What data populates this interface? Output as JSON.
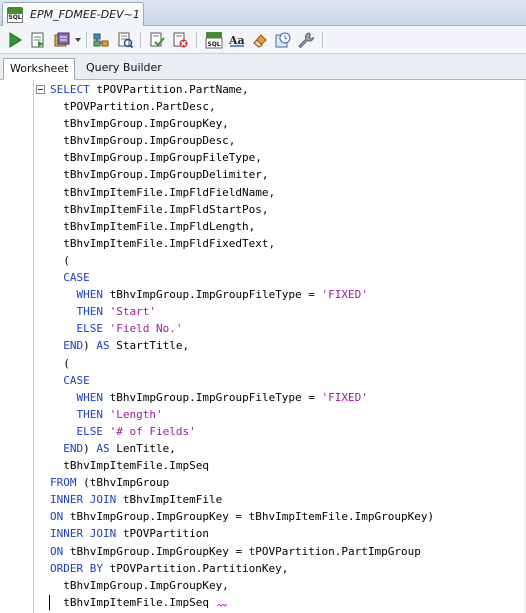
{
  "document_tab": {
    "title": "EPM_FDMEE-DEV~1",
    "icon": "sql-worksheet-icon"
  },
  "toolbar": {
    "buttons": [
      {
        "name": "run-statement-button",
        "icon": "play-icon"
      },
      {
        "name": "run-script-button",
        "icon": "script-icon"
      },
      {
        "name": "autotrace-button",
        "icon": "transaction-icon"
      },
      {
        "name": "explain-plan-button",
        "icon": "explain-plan-icon"
      },
      {
        "name": "sql-tuning-button",
        "icon": "tuning-icon"
      },
      {
        "name": "commit-button",
        "icon": "commit-icon"
      },
      {
        "name": "rollback-button",
        "icon": "rollback-icon"
      },
      {
        "name": "unshared-sql-button",
        "icon": "sql-icon"
      },
      {
        "name": "to-upper-lower-button",
        "icon": "case-icon"
      },
      {
        "name": "clear-button",
        "icon": "eraser-icon"
      },
      {
        "name": "sql-history-button",
        "icon": "history-icon"
      },
      {
        "name": "describe-button",
        "icon": "wrench-icon"
      }
    ]
  },
  "subtabs": {
    "worksheet": "Worksheet",
    "query_builder": "Query Builder",
    "active": "worksheet"
  },
  "editor": {
    "lines": [
      [
        {
          "t": "SELECT ",
          "c": "kw"
        },
        {
          "t": "tPOVPartition.PartName,"
        }
      ],
      [
        {
          "t": "  tPOVPartition.PartDesc,"
        }
      ],
      [
        {
          "t": "  tBhvImpGroup.ImpGroupKey,"
        }
      ],
      [
        {
          "t": "  tBhvImpGroup.ImpGroupDesc,"
        }
      ],
      [
        {
          "t": "  tBhvImpGroup.ImpGroupFileType,"
        }
      ],
      [
        {
          "t": "  tBhvImpGroup.ImpGroupDelimiter,"
        }
      ],
      [
        {
          "t": "  tBhvImpItemFile.ImpFldFieldName,"
        }
      ],
      [
        {
          "t": "  tBhvImpItemFile.ImpFldStartPos,"
        }
      ],
      [
        {
          "t": "  tBhvImpItemFile.ImpFldLength,"
        }
      ],
      [
        {
          "t": "  tBhvImpItemFile.ImpFldFixedText,"
        }
      ],
      [
        {
          "t": "  ("
        }
      ],
      [
        {
          "t": "  "
        },
        {
          "t": "CASE",
          "c": "kw"
        }
      ],
      [
        {
          "t": "    "
        },
        {
          "t": "WHEN ",
          "c": "kw"
        },
        {
          "t": "tBhvImpGroup.ImpGroupFileType = "
        },
        {
          "t": "'FIXED'",
          "c": "str"
        }
      ],
      [
        {
          "t": "    "
        },
        {
          "t": "THEN ",
          "c": "kw"
        },
        {
          "t": "'Start'",
          "c": "str"
        }
      ],
      [
        {
          "t": "    "
        },
        {
          "t": "ELSE ",
          "c": "kw"
        },
        {
          "t": "'Field No.'",
          "c": "str"
        }
      ],
      [
        {
          "t": "  "
        },
        {
          "t": "END",
          "c": "kw"
        },
        {
          "t": ") "
        },
        {
          "t": "AS ",
          "c": "kw"
        },
        {
          "t": "StartTitle,"
        }
      ],
      [
        {
          "t": "  ("
        }
      ],
      [
        {
          "t": "  "
        },
        {
          "t": "CASE",
          "c": "kw"
        }
      ],
      [
        {
          "t": "    "
        },
        {
          "t": "WHEN ",
          "c": "kw"
        },
        {
          "t": "tBhvImpGroup.ImpGroupFileType = "
        },
        {
          "t": "'FIXED'",
          "c": "str"
        }
      ],
      [
        {
          "t": "    "
        },
        {
          "t": "THEN ",
          "c": "kw"
        },
        {
          "t": "'Length'",
          "c": "str"
        }
      ],
      [
        {
          "t": "    "
        },
        {
          "t": "ELSE ",
          "c": "kw"
        },
        {
          "t": "'# of Fields'",
          "c": "str"
        }
      ],
      [
        {
          "t": "  "
        },
        {
          "t": "END",
          "c": "kw"
        },
        {
          "t": ") "
        },
        {
          "t": "AS ",
          "c": "kw"
        },
        {
          "t": "LenTitle,"
        }
      ],
      [
        {
          "t": "  tBhvImpItemFile.ImpSeq"
        }
      ],
      [
        {
          "t": "FROM ",
          "c": "kw"
        },
        {
          "t": "(tBhvImpGroup"
        }
      ],
      [
        {
          "t": "INNER JOIN ",
          "c": "kw"
        },
        {
          "t": "tBhvImpItemFile"
        }
      ],
      [
        {
          "t": "ON ",
          "c": "kw"
        },
        {
          "t": "tBhvImpGroup.ImpGroupKey = tBhvImpItemFile.ImpGroupKey)"
        }
      ],
      [
        {
          "t": "INNER JOIN ",
          "c": "kw"
        },
        {
          "t": "tPOVPartition"
        }
      ],
      [
        {
          "t": "ON ",
          "c": "kw"
        },
        {
          "t": "tBhvImpGroup.ImpGroupKey = tPOVPartition.PartImpGroup"
        }
      ],
      [
        {
          "t": "ORDER BY ",
          "c": "kw"
        },
        {
          "t": "tPOVPartition.PartitionKey,"
        }
      ],
      [
        {
          "t": "  tBhvImpGroup.ImpGroupKey,"
        }
      ],
      [
        {
          "t": "  tBhvImpItemFile.ImpSeq"
        }
      ]
    ]
  },
  "colors": {
    "keyword": "#1a3fc9",
    "string": "#a3189e",
    "text": "#000000"
  }
}
